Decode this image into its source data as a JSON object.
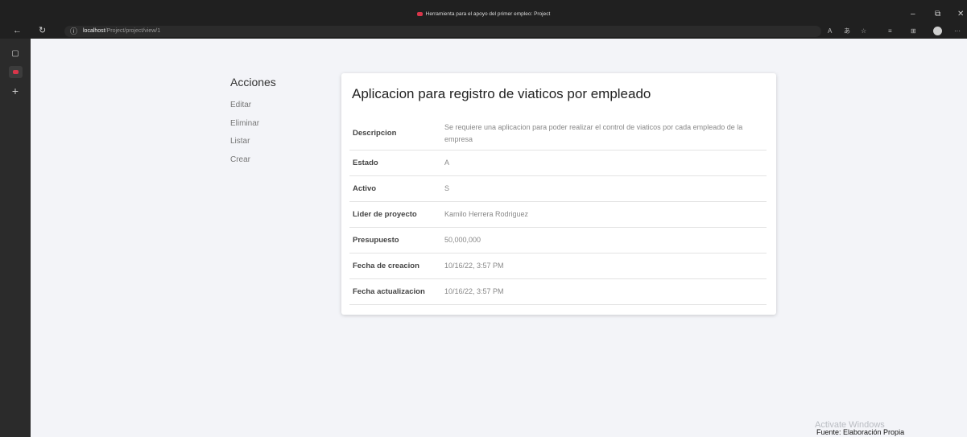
{
  "window": {
    "title": "Herramienta para el apoyo del primer empleo: Project",
    "minimize": "–",
    "restore": "⧉",
    "close": "✕"
  },
  "browser": {
    "back": "←",
    "reload": "↻",
    "url_host": "localhost",
    "url_path": "/Project/project/view/1",
    "toolbar": {
      "read_aloud": "A",
      "translate": "あ",
      "favorite": "☆",
      "favorites": "≡",
      "collections": "⊞",
      "more": "···"
    }
  },
  "sidebar": {
    "tabs_icon": "▢",
    "add": "+"
  },
  "actions": {
    "heading": "Acciones",
    "items": [
      "Editar",
      "Eliminar",
      "Listar",
      "Crear"
    ]
  },
  "project": {
    "title": "Aplicacion para registro de viaticos por empleado",
    "rows": [
      {
        "label": "Descripcion",
        "value": "Se requiere una aplicacion para poder realizar el control de viaticos por cada empleado de la empresa"
      },
      {
        "label": "Estado",
        "value": "A"
      },
      {
        "label": "Activo",
        "value": "S"
      },
      {
        "label": "Lider de proyecto",
        "value": "Kamilo Herrera Rodriguez"
      },
      {
        "label": "Presupuesto",
        "value": "50,000,000"
      },
      {
        "label": "Fecha de creacion",
        "value": "10/16/22, 3:57 PM"
      },
      {
        "label": "Fecha actualizacion",
        "value": "10/16/22, 3:57 PM"
      }
    ]
  },
  "watermark": "Activate Windows",
  "source_note": "Fuente: Elaboración Propia"
}
